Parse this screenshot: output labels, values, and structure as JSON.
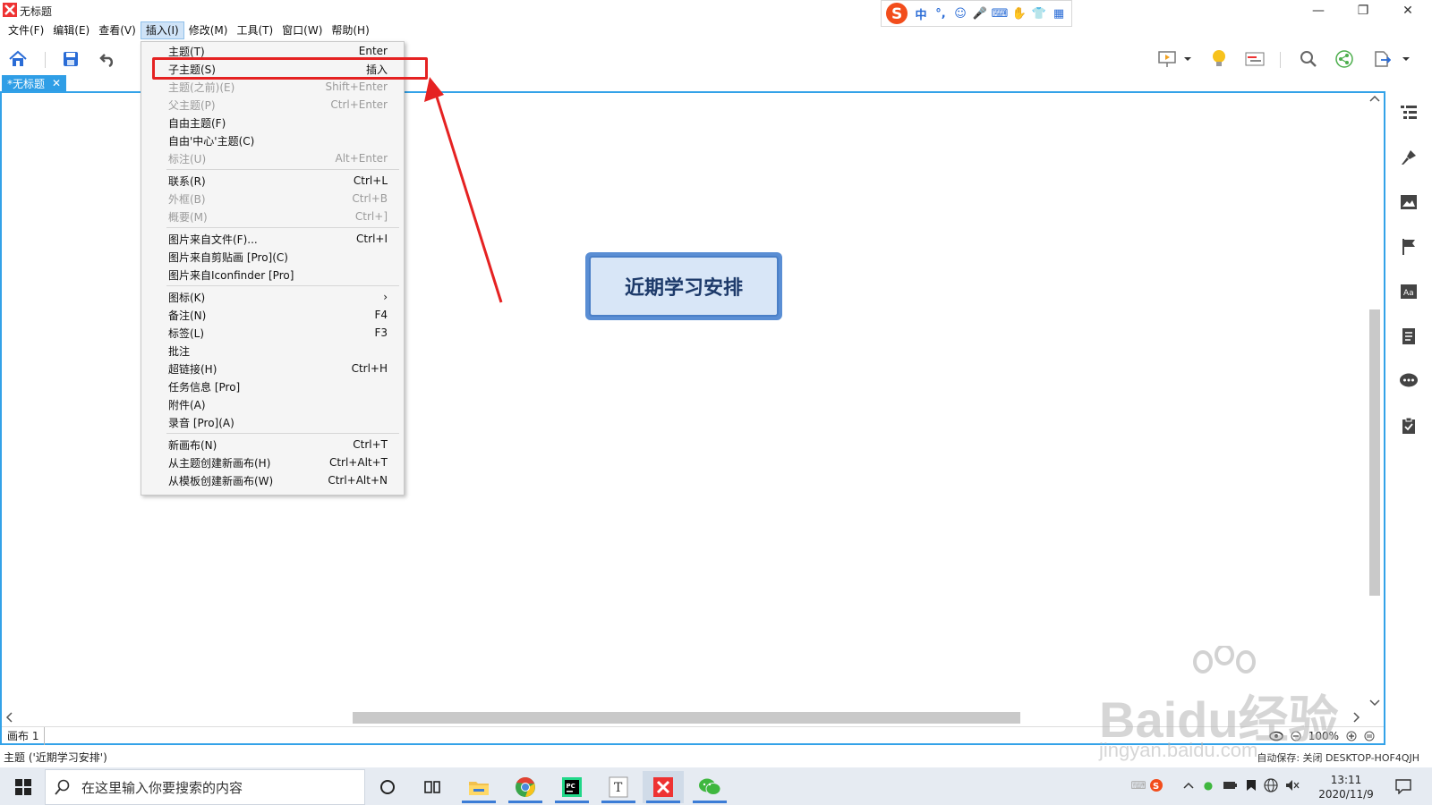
{
  "window": {
    "title": "无标题",
    "min": "—",
    "max": "❐",
    "close": "✕"
  },
  "ime": {
    "items": [
      "中",
      "°,",
      "☺",
      "🎤",
      "⌨",
      "✋",
      "👕",
      "▦"
    ]
  },
  "menubar": [
    {
      "label": "文件(F)"
    },
    {
      "label": "编辑(E)"
    },
    {
      "label": "查看(V)"
    },
    {
      "label": "插入(I)"
    },
    {
      "label": "修改(M)"
    },
    {
      "label": "工具(T)"
    },
    {
      "label": "窗口(W)"
    },
    {
      "label": "帮助(H)"
    }
  ],
  "tab": {
    "label": "*无标题",
    "close": "✕"
  },
  "insert_menu": {
    "items": [
      {
        "label": "主题(T)",
        "shortcut": "Enter",
        "enabled": true
      },
      {
        "label": "子主题(S)",
        "shortcut": "插入",
        "enabled": true
      },
      {
        "label": "主题(之前)(E)",
        "shortcut": "Shift+Enter",
        "enabled": false
      },
      {
        "label": "父主题(P)",
        "shortcut": "Ctrl+Enter",
        "enabled": false
      },
      {
        "label": "自由主题(F)",
        "shortcut": "",
        "enabled": true
      },
      {
        "label": "自由'中心'主题(C)",
        "shortcut": "",
        "enabled": true
      },
      {
        "label": "标注(U)",
        "shortcut": "Alt+Enter",
        "enabled": false
      },
      {
        "label": "联系(R)",
        "shortcut": "Ctrl+L",
        "enabled": true
      },
      {
        "label": "外框(B)",
        "shortcut": "Ctrl+B",
        "enabled": false
      },
      {
        "label": "概要(M)",
        "shortcut": "Ctrl+]",
        "enabled": false
      },
      {
        "label": "图片来自文件(F)...",
        "shortcut": "Ctrl+I",
        "enabled": true
      },
      {
        "label": "图片来自剪贴画 [Pro](C)",
        "shortcut": "",
        "enabled": true
      },
      {
        "label": "图片来自Iconfinder [Pro]",
        "shortcut": "",
        "enabled": true
      },
      {
        "label": "图标(K)",
        "shortcut": "›",
        "enabled": true
      },
      {
        "label": "备注(N)",
        "shortcut": "F4",
        "enabled": true
      },
      {
        "label": "标签(L)",
        "shortcut": "F3",
        "enabled": true
      },
      {
        "label": "批注",
        "shortcut": "",
        "enabled": true
      },
      {
        "label": "超链接(H)",
        "shortcut": "Ctrl+H",
        "enabled": true
      },
      {
        "label": "任务信息 [Pro]",
        "shortcut": "",
        "enabled": true
      },
      {
        "label": "附件(A)",
        "shortcut": "",
        "enabled": true
      },
      {
        "label": "录音 [Pro](A)",
        "shortcut": "",
        "enabled": true
      },
      {
        "label": "新画布(N)",
        "shortcut": "Ctrl+T",
        "enabled": true
      },
      {
        "label": "从主题创建新画布(H)",
        "shortcut": "Ctrl+Alt+T",
        "enabled": true
      },
      {
        "label": "从模板创建新画布(W)",
        "shortcut": "Ctrl+Alt+N",
        "enabled": true
      }
    ]
  },
  "canvas": {
    "central_topic": "近期学习安排"
  },
  "sheet": {
    "tab": "画布 1",
    "zoom": "100%"
  },
  "status": {
    "left": "主题 ('近期学习安排')",
    "right": "自动保存: 关闭  DESKTOP-HOF4QJH"
  },
  "taskbar": {
    "search_placeholder": "在这里输入你要搜索的内容",
    "time": "13:11",
    "date": "2020/11/9"
  },
  "watermark": {
    "main": "Baidu经验",
    "sub": "jingyan.baidu.com"
  },
  "colors": {
    "accent": "#33a2e8",
    "highlight": "#e52222",
    "topic_border": "#4a7fc7"
  }
}
